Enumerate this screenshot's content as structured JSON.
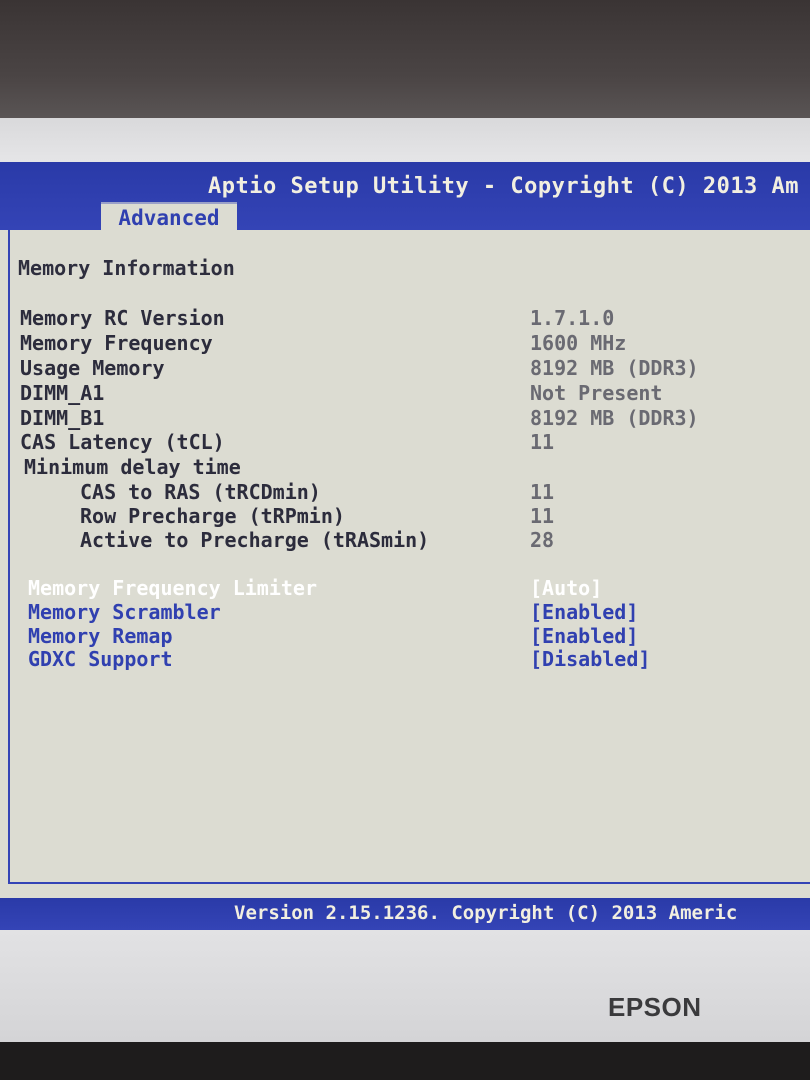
{
  "header": {
    "title": "Aptio Setup Utility - Copyright (C) 2013 Am",
    "active_tab": "Advanced"
  },
  "section_title": "Memory Information",
  "info_rows": [
    {
      "label": "Memory RC Version",
      "value": "1.7.1.0"
    },
    {
      "label": "Memory Frequency",
      "value": "1600 MHz"
    },
    {
      "label": "Usage Memory",
      "value": "8192 MB (DDR3)"
    },
    {
      "label": "DIMM_A1",
      "value": "Not Present"
    },
    {
      "label": "DIMM_B1",
      "value": "8192 MB (DDR3)"
    },
    {
      "label": "CAS Latency (tCL)",
      "value": "11"
    },
    {
      "label": "Minimum delay time",
      "value": ""
    },
    {
      "label": "CAS to RAS (tRCDmin)",
      "value": "11"
    },
    {
      "label": "Row Precharge (tRPmin)",
      "value": "11"
    },
    {
      "label": "Active to Precharge (tRASmin)",
      "value": "28"
    }
  ],
  "options": [
    {
      "label": "Memory Frequency Limiter",
      "value": "[Auto]",
      "selected": true
    },
    {
      "label": "Memory Scrambler",
      "value": "[Enabled]",
      "selected": false
    },
    {
      "label": "Memory Remap",
      "value": "[Enabled]",
      "selected": false
    },
    {
      "label": "GDXC Support",
      "value": "[Disabled]",
      "selected": false
    }
  ],
  "footer": {
    "text": "Version 2.15.1236. Copyright (C) 2013 Americ"
  },
  "monitor": {
    "brand": "EPSON"
  },
  "colors": {
    "bar_blue": "#3444b6",
    "screen_bg": "#dcdcd2",
    "option_blue": "#3040b0",
    "selected_text": "#ffffff"
  }
}
